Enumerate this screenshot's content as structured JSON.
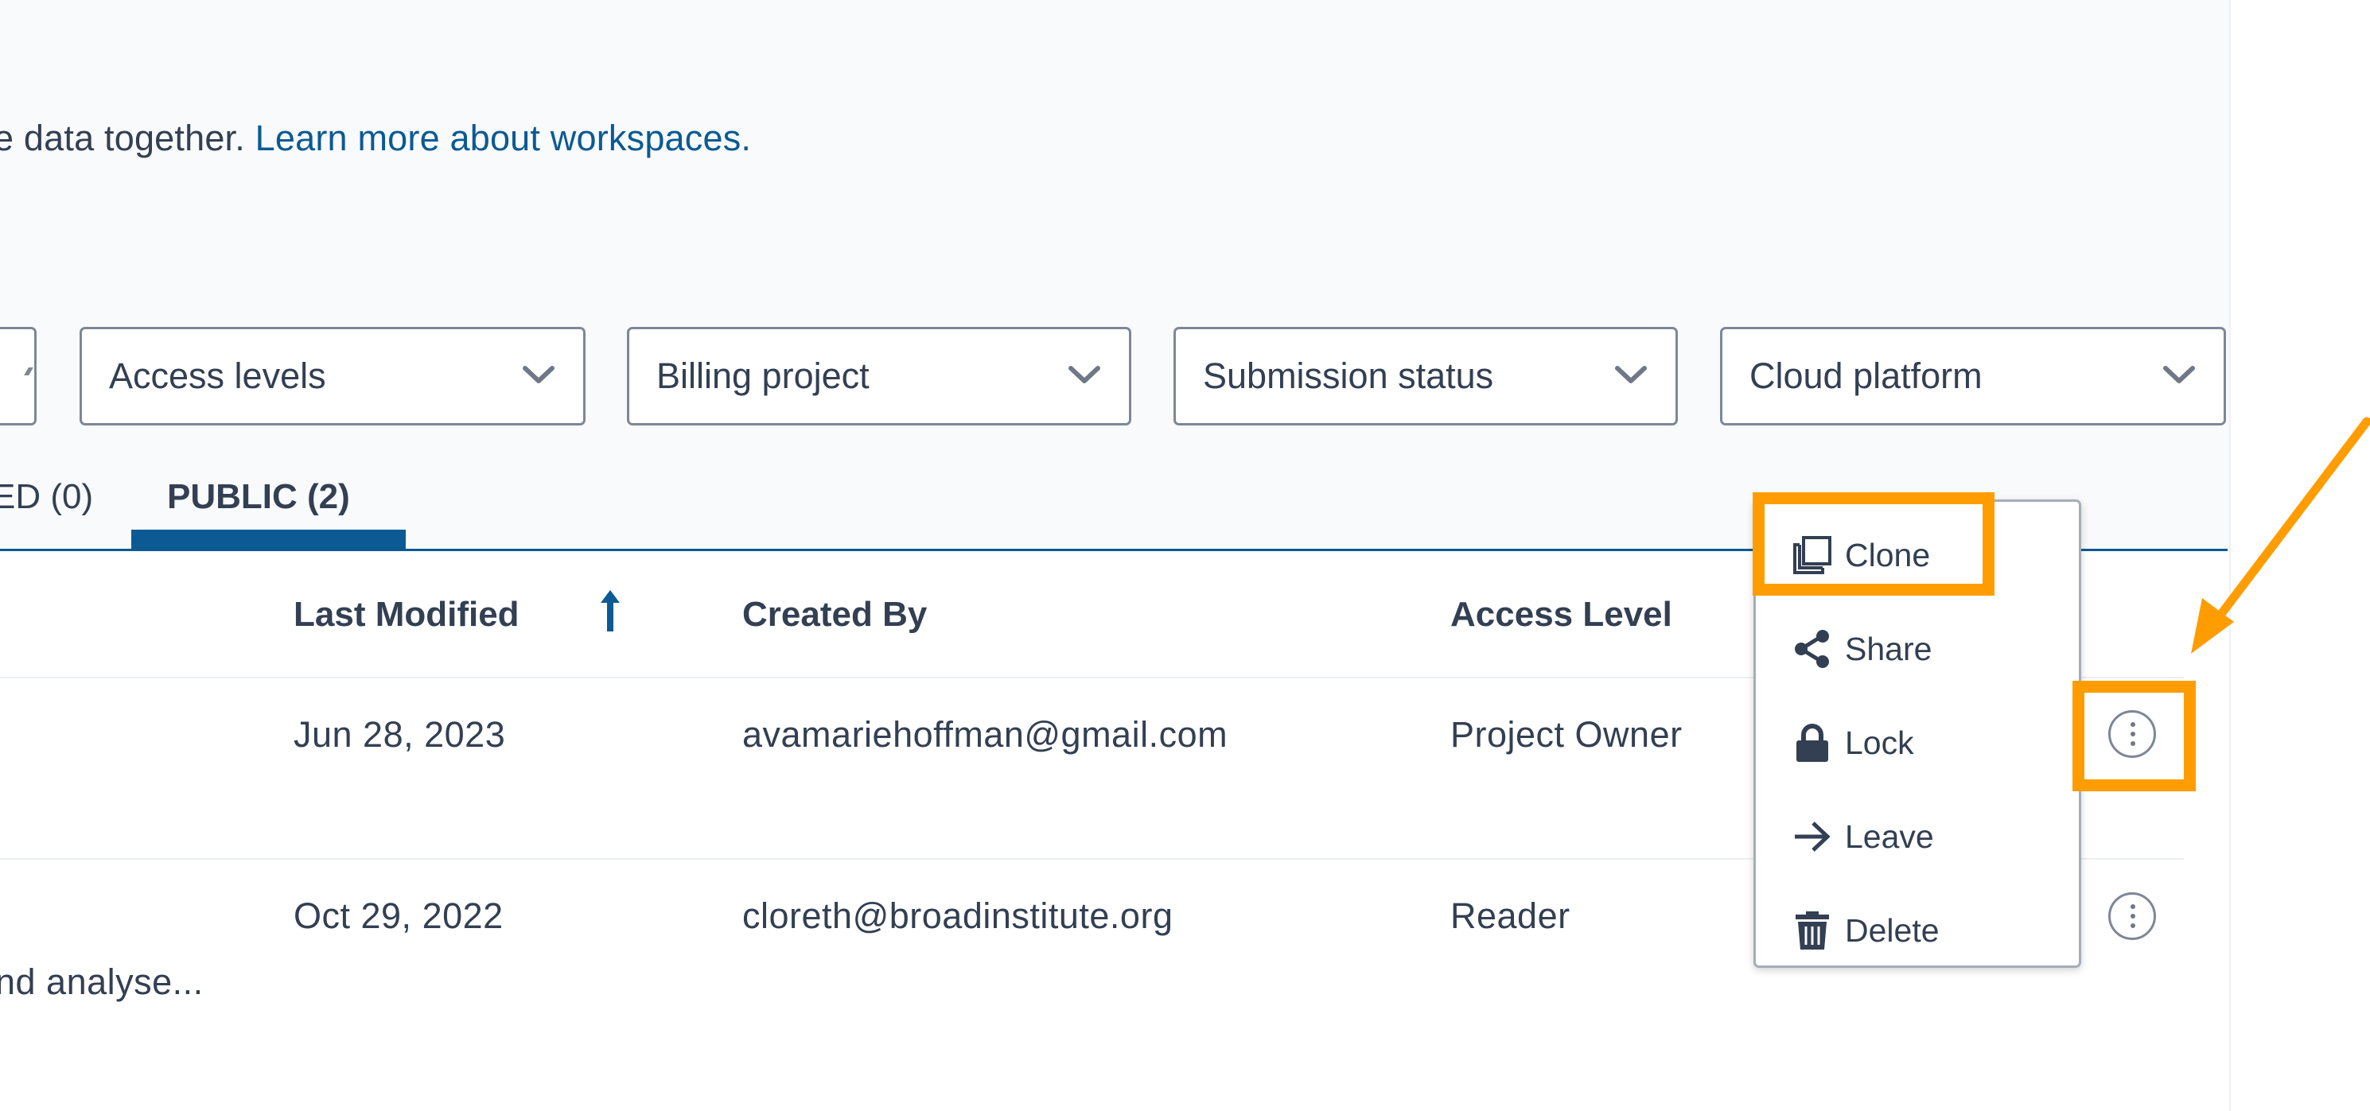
{
  "intro": {
    "text": "e data together. ",
    "link": "Learn more about workspaces."
  },
  "filters": [
    {
      "label": "Access levels"
    },
    {
      "label": "Billing project"
    },
    {
      "label": "Submission status"
    },
    {
      "label": "Cloud platform"
    }
  ],
  "tabs": {
    "prev": "ED (0)",
    "active": "PUBLIC (2)"
  },
  "table": {
    "columns": {
      "last_modified": "Last Modified",
      "created_by": "Created By",
      "access_level": "Access Level"
    },
    "rows": [
      {
        "description": "",
        "last_modified": "Jun 28, 2023",
        "created_by": "avamariehoffman@gmail.com",
        "access_level": "Project Owner"
      },
      {
        "description": "nd analyse...",
        "last_modified": "Oct 29, 2022",
        "created_by": "cloreth@broadinstitute.org",
        "access_level": "Reader"
      }
    ]
  },
  "menu": {
    "items": [
      {
        "label": "Clone",
        "icon": "clone-icon"
      },
      {
        "label": "Share",
        "icon": "share-icon"
      },
      {
        "label": "Lock",
        "icon": "lock-icon"
      },
      {
        "label": "Leave",
        "icon": "arrow-right-icon"
      },
      {
        "label": "Delete",
        "icon": "trash-icon"
      }
    ]
  },
  "colors": {
    "link": "#0b5a93",
    "text": "#333f52",
    "highlight": "#ff9d00",
    "border": "#7d8797"
  }
}
